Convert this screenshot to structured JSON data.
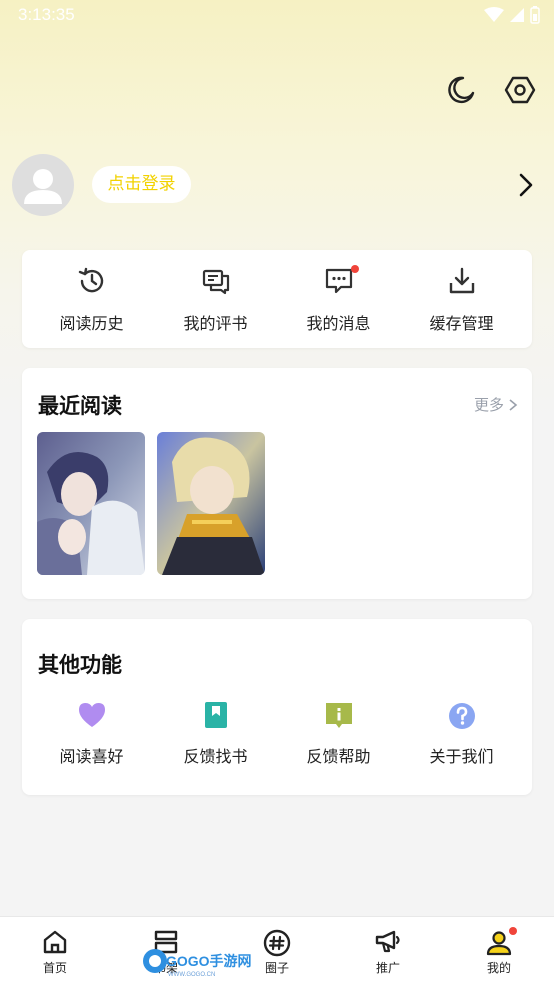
{
  "status_bar": {
    "time": "3:13:35"
  },
  "header": {
    "night_mode_icon": "moon-icon",
    "settings_icon": "hexagon-settings-icon"
  },
  "profile": {
    "login_label": "点击登录",
    "arrow_icon": "chevron-right-icon",
    "login_color": "#f2d200"
  },
  "quick_actions": [
    {
      "label": "阅读历史",
      "icon": "history-clock-icon"
    },
    {
      "label": "我的评书",
      "icon": "comments-icon"
    },
    {
      "label": "我的消息",
      "icon": "message-bubble-icon",
      "badge": true
    },
    {
      "label": "缓存管理",
      "icon": "download-tray-icon"
    }
  ],
  "recent": {
    "title": "最近阅读",
    "more_label": "更多",
    "covers": [
      {
        "icon": "book-cover-1"
      },
      {
        "icon": "book-cover-2"
      }
    ]
  },
  "other": {
    "title": "其他功能",
    "items": [
      {
        "label": "阅读喜好",
        "icon": "heart-icon",
        "color": "#b08cf0"
      },
      {
        "label": "反馈找书",
        "icon": "bookmark-icon",
        "color": "#2ab3a6"
      },
      {
        "label": "反馈帮助",
        "icon": "info-flag-icon",
        "color": "#a7b94a"
      },
      {
        "label": "关于我们",
        "icon": "question-icon",
        "color": "#8aa6f2"
      }
    ]
  },
  "tabbar": [
    {
      "label": "首页",
      "icon": "home-icon"
    },
    {
      "label": "书架",
      "icon": "bookshelf-icon"
    },
    {
      "label": "圈子",
      "icon": "hashtag-icon"
    },
    {
      "label": "推广",
      "icon": "megaphone-icon"
    },
    {
      "label": "我的",
      "icon": "user-icon",
      "badge": true
    }
  ],
  "watermark": {
    "text": "GOGO手游网",
    "subtext": "WWW.GOGO.CN"
  }
}
